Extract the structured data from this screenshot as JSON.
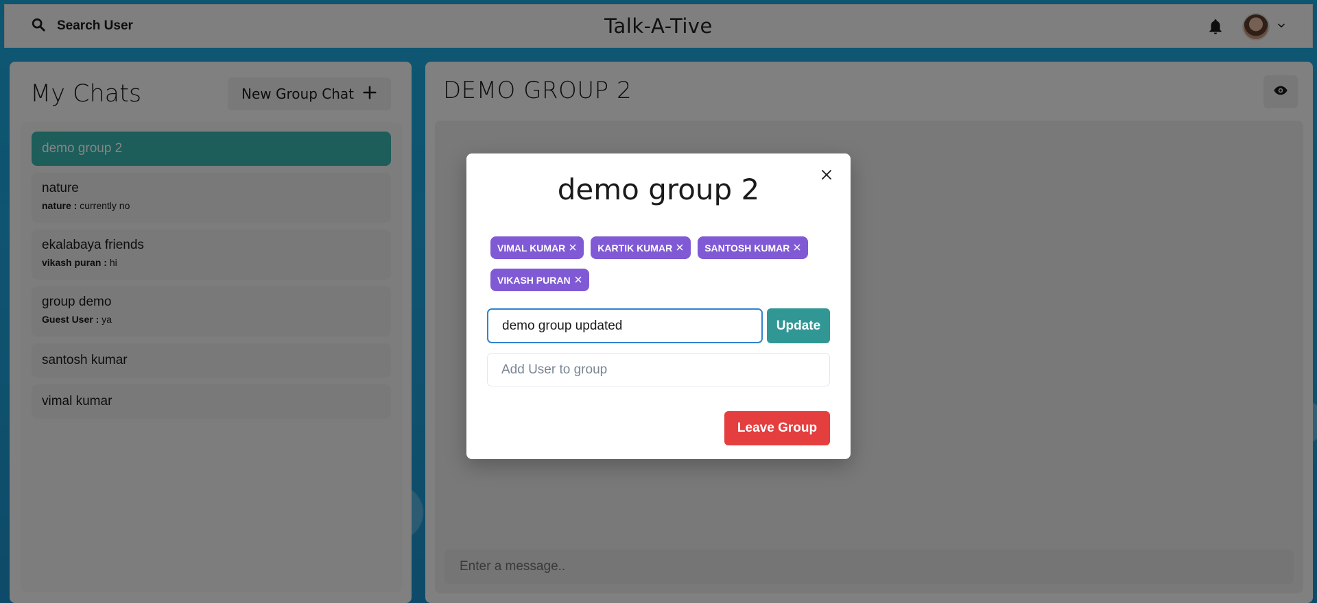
{
  "header": {
    "search_label": "Search User",
    "app_title": "Talk-A-Tive",
    "icons": [
      "search-icon",
      "bell-icon",
      "avatar",
      "chevron-down-icon"
    ]
  },
  "sidebar": {
    "title": "My Chats",
    "new_group_label": "New Group Chat",
    "new_group_icon": "plus-icon",
    "chats": [
      {
        "name": "demo group 2",
        "active": true
      },
      {
        "name": "nature",
        "latest_sender": "nature :",
        "latest_message": "currently no"
      },
      {
        "name": "ekalabaya friends",
        "latest_sender": "vikash puran :",
        "latest_message": "hi"
      },
      {
        "name": "group demo",
        "latest_sender": "Guest User :",
        "latest_message": "ya"
      },
      {
        "name": "santosh kumar"
      },
      {
        "name": "vimal kumar"
      }
    ]
  },
  "chat": {
    "title": "DEMO GROUP 2",
    "view_icon": "eye-icon",
    "message_placeholder": "Enter a message.."
  },
  "modal": {
    "title": "demo group 2",
    "close_icon": "close-icon",
    "members": [
      "VIMAL KUMAR",
      "KARTIK KUMAR",
      "SANTOSH KUMAR",
      "VIKASH PURAN"
    ],
    "rename_value": "demo group updated",
    "update_label": "Update",
    "add_user_placeholder": "Add User to group",
    "leave_label": "Leave Group"
  },
  "colors": {
    "accent_teal": "#38b2ac",
    "chip_purple": "#805ad5",
    "update_teal": "#319795",
    "leave_red": "#e53e3e",
    "focus_blue": "#3182ce"
  }
}
